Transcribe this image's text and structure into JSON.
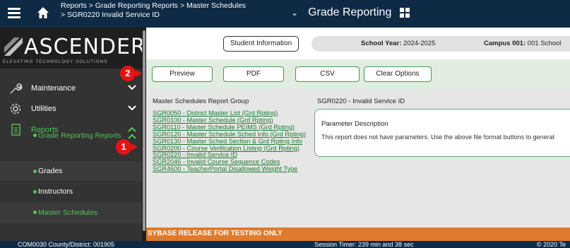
{
  "header": {
    "breadcrumb_line1": "Reports > Grade Reporting Reports > Master Schedules",
    "breadcrumb_line2": "> SGR0220 Invalid Service ID",
    "module_title": "Grade Reporting"
  },
  "brand": {
    "name": "ASCENDER",
    "tagline": "ELEVATING TECHNOLOGY SOLUTIONS"
  },
  "sidebar": {
    "items": [
      {
        "label": "Maintenance"
      },
      {
        "label": "Utilities"
      },
      {
        "label": "Reports"
      }
    ],
    "subitems": [
      {
        "label": "Grade Reporting Reports"
      },
      {
        "label": "Grades"
      },
      {
        "label": "Instructors"
      },
      {
        "label": "Master Schedules"
      }
    ]
  },
  "topinfo": {
    "student_info_button": "Student Information",
    "school_year_label": "School Year:",
    "school_year_value": "2024-2025",
    "campus_label": "Campus 001:",
    "campus_value": "001 School"
  },
  "toolbar": {
    "preview": "Preview",
    "pdf": "PDF",
    "csv": "CSV",
    "clear": "Clear Options"
  },
  "report_group": {
    "title": "Master Schedules Report Group",
    "reports": [
      "SGR0050 - District Master List (Grd Rpting)",
      "SGR0100 - Master Schedule (Grd Rpting)",
      "SGR0110 - Master Schedule PEIMS (Grd Rpting)",
      "SGR0120 - Master Schedule Sched Info (Grd Rpting)",
      "SGR0130 - Master Sched Section & Grd Rpting Info",
      "SGR0200 - Course Verification Listing (Grd Rpting)",
      "SGR0220 - Invalid Service ID",
      "SGR2046 - Invalid Course Sequence Codes",
      "SGR4600 - TeacherPortal Disallowed Weight Type"
    ]
  },
  "selected_report": {
    "title": "SGR0220 - Invalid Service ID",
    "param_heading": "Parameter Description",
    "param_text": "This report does not have parameters. Use the above file format buttons to generat"
  },
  "callouts": {
    "one": "1",
    "two": "2"
  },
  "banner": "SYBASE RELEASE FOR TESTING ONLY",
  "footer": {
    "left": "COM0030  County/District: 001905",
    "session": "Session Timer:  239 min and 38 sec",
    "right": "© 2020 Te"
  },
  "colors": {
    "header_bg": "#0f2a45",
    "sidebar_bg": "#333333",
    "accent_green": "#55c25a",
    "link_green": "#1c7a2e",
    "banner_orange": "#e07a2c",
    "callout_red": "#e41414"
  }
}
